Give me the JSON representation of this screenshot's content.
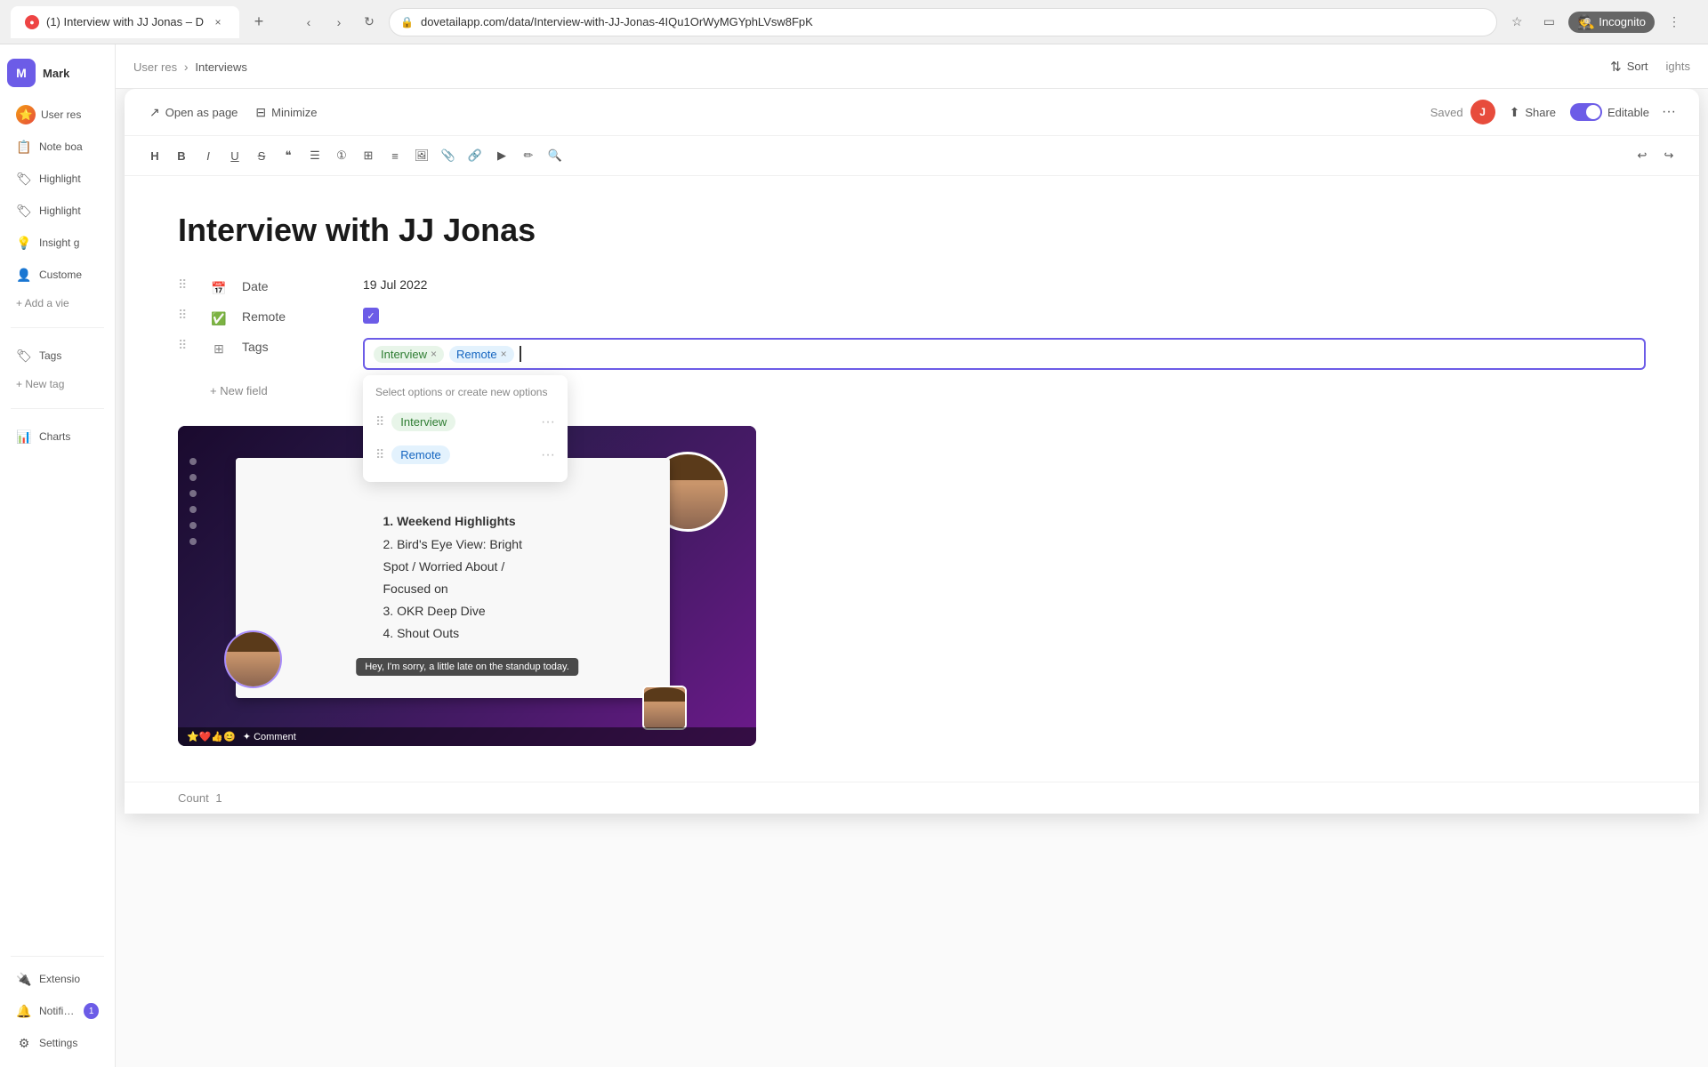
{
  "browser": {
    "tab_title": "(1) Interview with JJ Jonas – D",
    "tab_close": "×",
    "new_tab": "+",
    "address": "dovetailapp.com/data/Interview-with-JJ-Jonas-4IQu1OrWyMGYphLVsw8FpK",
    "incognito": "Incognito"
  },
  "doc_toolbar": {
    "open_as_page": "Open as page",
    "minimize": "Minimize",
    "saved": "Saved",
    "user_initial": "J",
    "share": "Share",
    "editable": "Editable",
    "more": "···"
  },
  "format_toolbar": {
    "heading": "H",
    "bold": "B",
    "italic": "I",
    "underline": "U",
    "strikethrough": "S",
    "blockquote": "❝",
    "bullet": "☰",
    "numbered": "①",
    "table": "⊞",
    "align": "≡",
    "image": "🖼",
    "attachment": "📎",
    "link": "🔗",
    "video": "▶",
    "draw": "✏",
    "search": "🔍",
    "undo": "↩",
    "redo": "↪"
  },
  "document": {
    "title": "Interview with JJ Jonas",
    "date_label": "Date",
    "date_value": "19 Jul 2022",
    "remote_label": "Remote",
    "tags_label": "Tags",
    "new_field_label": "+ New field",
    "tag_interview": "Interview",
    "tag_remote": "Remote",
    "dropdown_hint": "Select options or create new options",
    "dropdown_tags": [
      {
        "label": "Interview",
        "style": "interview"
      },
      {
        "label": "Remote",
        "style": "remote"
      }
    ],
    "count_label": "Count",
    "count_value": "1"
  },
  "sidebar": {
    "workspace_initial": "M",
    "workspace_name": "Mark",
    "items": [
      {
        "id": "user-res",
        "label": "User res",
        "icon": "🌟"
      },
      {
        "id": "note-boards",
        "label": "Note boa",
        "icon": "📋"
      },
      {
        "id": "highlights1",
        "label": "Highlight",
        "icon": "🏷"
      },
      {
        "id": "highlights2",
        "label": "Highlight",
        "icon": "🏷"
      },
      {
        "id": "insight-g",
        "label": "Insight g",
        "icon": "💡"
      },
      {
        "id": "customer",
        "label": "Custome",
        "icon": "👤"
      }
    ],
    "add_view": "+ Add a vie",
    "tags_label": "Tags",
    "new_tag": "+ New tag",
    "charts_label": "Charts",
    "extensions_label": "Extensio",
    "notifications_label": "Notificati",
    "settings_label": "Settings",
    "notification_count": "1"
  },
  "video": {
    "screen_lines": [
      "1. Weekend Highlights",
      "2. Bird's Eye View: Bright Spot / Worried About / Focused on",
      "3. OKR Deep Dive",
      "4. Shout Outs"
    ],
    "toast": "Hey, I'm sorry, a little late on the standup today."
  },
  "header": {
    "sort_label": "Sort",
    "highlights_label": "ights"
  }
}
